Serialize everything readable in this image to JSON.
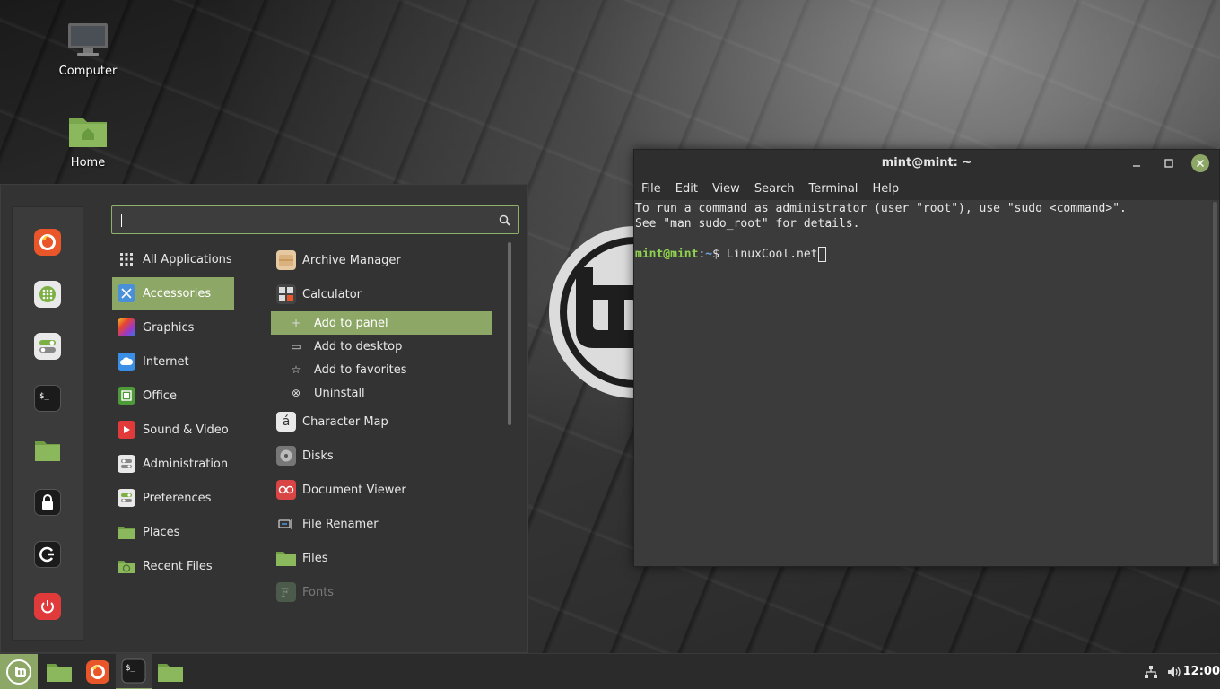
{
  "desktop": {
    "icons": [
      {
        "label": "Computer",
        "icon": "computer-icon"
      },
      {
        "label": "Home",
        "icon": "home-folder-icon"
      }
    ]
  },
  "menu": {
    "search": {
      "value": "",
      "placeholder": ""
    },
    "favorites": [
      {
        "name": "Firefox",
        "icon": "firefox-icon"
      },
      {
        "name": "Software Manager",
        "icon": "software-manager-icon"
      },
      {
        "name": "System Settings",
        "icon": "system-settings-icon"
      },
      {
        "name": "Terminal",
        "icon": "terminal-icon"
      },
      {
        "name": "Files",
        "icon": "folder-icon"
      },
      {
        "name": "Lock Screen",
        "icon": "lock-icon"
      },
      {
        "name": "Logout",
        "icon": "logout-icon"
      },
      {
        "name": "Quit",
        "icon": "power-icon"
      }
    ],
    "categories": [
      {
        "label": "All Applications",
        "icon": "grid-icon",
        "selected": false
      },
      {
        "label": "Accessories",
        "icon": "accessories-icon",
        "selected": true
      },
      {
        "label": "Graphics",
        "icon": "graphics-icon",
        "selected": false
      },
      {
        "label": "Internet",
        "icon": "internet-icon",
        "selected": false
      },
      {
        "label": "Office",
        "icon": "office-icon",
        "selected": false
      },
      {
        "label": "Sound & Video",
        "icon": "sound-video-icon",
        "selected": false
      },
      {
        "label": "Administration",
        "icon": "administration-icon",
        "selected": false
      },
      {
        "label": "Preferences",
        "icon": "preferences-icon",
        "selected": false
      },
      {
        "label": "Places",
        "icon": "places-icon",
        "selected": false
      },
      {
        "label": "Recent Files",
        "icon": "recent-files-icon",
        "selected": false
      }
    ],
    "apps": [
      {
        "label": "Archive Manager",
        "icon": "archive-manager-icon"
      },
      {
        "label": "Calculator",
        "icon": "calculator-icon"
      },
      {
        "label": "Character Map",
        "icon": "character-map-icon"
      },
      {
        "label": "Disks",
        "icon": "disks-icon"
      },
      {
        "label": "Document Viewer",
        "icon": "document-viewer-icon"
      },
      {
        "label": "File Renamer",
        "icon": "file-renamer-icon"
      },
      {
        "label": "Files",
        "icon": "files-icon"
      },
      {
        "label": "Fonts",
        "icon": "fonts-icon"
      }
    ],
    "context_menu": [
      {
        "label": "Add to panel",
        "icon": "plus-icon",
        "selected": true
      },
      {
        "label": "Add to desktop",
        "icon": "desktop-icon",
        "selected": false
      },
      {
        "label": "Add to favorites",
        "icon": "star-icon",
        "selected": false
      },
      {
        "label": "Uninstall",
        "icon": "uninstall-icon",
        "selected": false
      }
    ]
  },
  "terminal": {
    "title": "mint@mint: ~",
    "menubar": [
      "File",
      "Edit",
      "View",
      "Search",
      "Terminal",
      "Help"
    ],
    "lines": [
      "To run a command as administrator (user \"root\"), use \"sudo <command>\".",
      "See \"man sudo_root\" for details."
    ],
    "prompt": {
      "user_host": "mint@mint",
      "separator": ":",
      "path": "~",
      "symbol": "$ ",
      "input": "LinuxCool.net"
    }
  },
  "panel": {
    "launchers": [
      {
        "name": "Menu",
        "icon": "mint-menu-icon"
      },
      {
        "name": "Files",
        "icon": "folder-icon"
      },
      {
        "name": "Firefox",
        "icon": "firefox-icon"
      },
      {
        "name": "Terminal",
        "icon": "terminal-icon"
      },
      {
        "name": "Files",
        "icon": "folder-icon"
      }
    ],
    "tray": [
      {
        "name": "Network",
        "icon": "network-icon"
      },
      {
        "name": "Volume",
        "icon": "volume-icon"
      }
    ],
    "clock": "12:00"
  },
  "colors": {
    "accent": "#8da766",
    "prompt_user": "#8fd14f",
    "prompt_path": "#6fa3e0",
    "panel_bg": "#2b2b2b",
    "menu_bg": "#333333"
  }
}
